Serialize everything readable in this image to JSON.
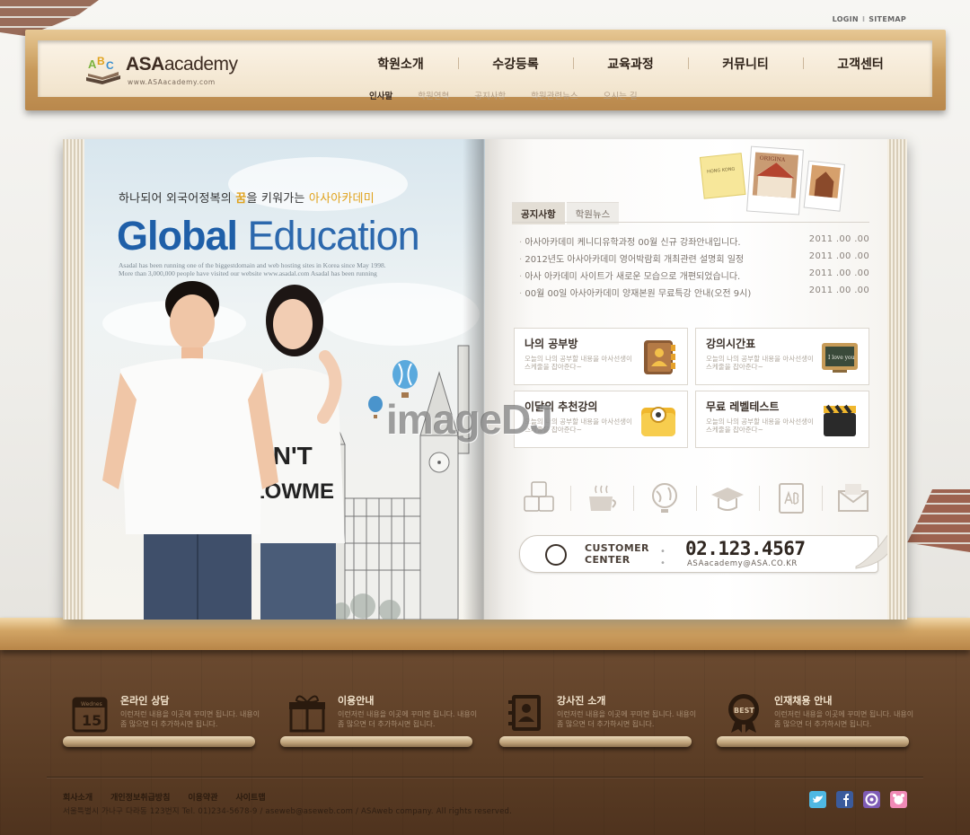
{
  "header": {
    "util_links": {
      "login": "LOGIN",
      "sitemap": "SITEMAP"
    },
    "logo": {
      "abc": "ABC",
      "name_bold": "ASA",
      "name_rest": "academy",
      "url": "www.ASAacademy.com"
    },
    "gnb": [
      "학원소개",
      "수강등록",
      "교육과정",
      "커뮤니티",
      "고객센터"
    ],
    "sub_nav": [
      "인사말",
      "학원연혁",
      "공지사항",
      "학원관련뉴스",
      "오시는 길"
    ],
    "sub_nav_active": "인사말"
  },
  "hero": {
    "slogan_part1": "하나되어 외국어정복의 ",
    "slogan_hl": "꿈",
    "slogan_part2": "을 키워가는 ",
    "slogan_brand": "아사아카데미",
    "title_1": "Global",
    "title_2": " Education",
    "desc_1": "Asadal has been running one of the biggestdomain and web hosting sites in Korea since May 1998.",
    "desc_2": "More than 3,000,000 people have  visited our website www.asadal.com Asadal has been running",
    "shirt_text_1": "ON'T",
    "shirt_text_2": "LOWME"
  },
  "polaroids": {
    "note": "HONG KONG",
    "photo": "ORIGINA"
  },
  "notice": {
    "tabs": [
      "공지사항",
      "학원뉴스"
    ],
    "items": [
      {
        "title": "아사아카데미 케니디유학과정 00월 신규 강좌안내입니다.",
        "date": "2011 .00 .00"
      },
      {
        "title": "2012년도 아사아카데미 영어박람회 개최관련 설명회 일정",
        "date": "2011 .00 .00"
      },
      {
        "title": "아사 아카데미 사이트가 새로운 모습으로 개편되었습니다.",
        "date": "2011 .00 .00"
      },
      {
        "title": "00월 00일 아사아카데미 양재본원 무료특강 안내(오전 9시)",
        "date": "2011 .00 .00"
      }
    ]
  },
  "boxes": [
    {
      "title": "나의 공부방",
      "desc": "오늘의 나의 공부할 내용을 아사선생이 스케줄을 잡아준다~"
    },
    {
      "title": "강의시간표",
      "desc": "오늘의 나의 공부할 내용을 아사선생이 스케줄을 잡아준다~",
      "icon_text": "I love you"
    },
    {
      "title": "이달의 추천강의",
      "desc": "오늘의 나의 공부할 내용을 아사선생이 스케줄을 잡아준다~"
    },
    {
      "title": "무료 레벨테스트",
      "desc": "오늘의 나의 공부할 내용을 아사선생이 스케줄을 잡아준다~"
    }
  ],
  "icon_row": [
    "abc-blocks-icon",
    "coffee-cup-icon",
    "globe-icon",
    "graduation-cap-icon",
    "ab-book-icon",
    "mail-icon"
  ],
  "customer_center": {
    "label_1": "CUSTOMER",
    "label_2": "CENTER",
    "phone": "02.123.4567",
    "email": "ASAacademy@ASA.CO.KR"
  },
  "watermark": "imageDJ",
  "quick_links": [
    {
      "title": "온라인 상담",
      "desc": "이런저런 내용을 이곳에 꾸미면 됩니다. 내용이 좀 많으면 더 추가하시면 됩니다.",
      "icon": "calendar-icon",
      "icon_day": "Wednes",
      "icon_num": "15"
    },
    {
      "title": "이용안내",
      "desc": "이런저런 내용을 이곳에 꾸미면 됩니다. 내용이 좀 많으면 더 추가하시면 됩니다.",
      "icon": "gift-icon"
    },
    {
      "title": "강사진 소개",
      "desc": "이런저런 내용을 이곳에 꾸미면 됩니다. 내용이 좀 많으면 더 추가하시면 됩니다.",
      "icon": "contact-book-icon"
    },
    {
      "title": "인재채용 안내",
      "desc": "이런저런 내용을 이곳에 꾸미면 됩니다. 내용이 좀 많으면 더 추가하시면 됩니다.",
      "icon": "best-badge-icon",
      "icon_text": "BEST"
    }
  ],
  "footer": {
    "links": [
      "회사소개",
      "개인정보취급방침",
      "이용약관",
      "사이트맵"
    ],
    "address": "서울특별시 가나구 다라동 123번지  Tel. 01)234-5678-9 / aseweb@aseweb.com / ASAweb company. All rights reserved.",
    "social": [
      "twitter-icon",
      "facebook-icon",
      "me2day-icon",
      "cyworld-icon"
    ]
  },
  "colors": {
    "accent": "#e0a21c",
    "title_blue": "#1f5fa8",
    "wood_dark": "#5b3d25"
  }
}
